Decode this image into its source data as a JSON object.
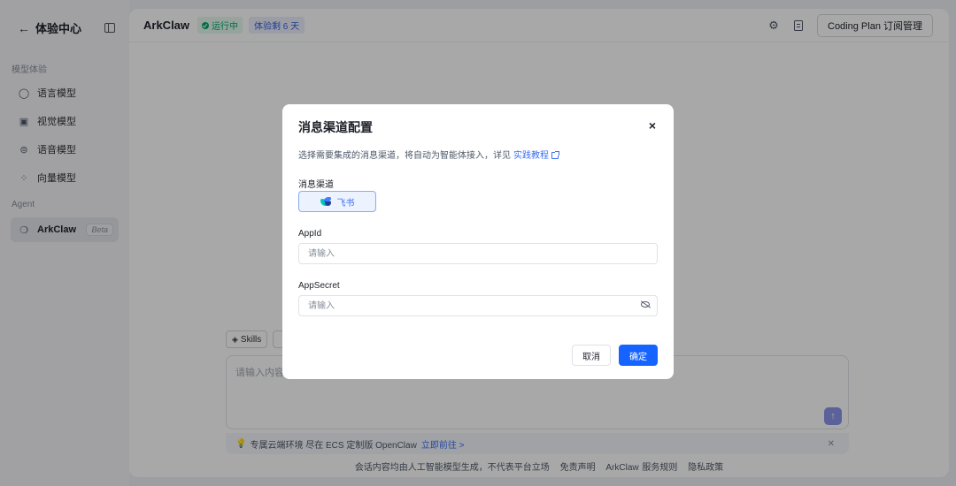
{
  "sidebar": {
    "back_icon": "arrow-left-icon",
    "title": "体验中心",
    "collapse_icon": "sidebar-collapse-icon",
    "section_model": "模型体验",
    "items": [
      {
        "label": "语言模型",
        "icon": "chat-bubble-icon"
      },
      {
        "label": "视觉模型",
        "icon": "image-icon"
      },
      {
        "label": "语音模型",
        "icon": "audio-icon"
      },
      {
        "label": "向量模型",
        "icon": "vector-icon"
      }
    ],
    "section_agent": "Agent",
    "agent_item": {
      "label": "ArkClaw",
      "badge": "Beta",
      "icon": "arkclaw-icon"
    }
  },
  "header": {
    "app_name": "ArkClaw",
    "status": "运行中",
    "trial": "体验剩 6 天",
    "plan_button": "Coding Plan 订阅管理",
    "settings_icon": "gear-icon",
    "doc_icon": "document-icon"
  },
  "chat": {
    "skills_label": "Skills",
    "input_placeholder": "请输入内容",
    "notice_text": "专属云端环境  尽在 ECS 定制版 OpenClaw",
    "notice_link": "立即前往 >",
    "footer": [
      "会话内容均由人工智能模型生成，不代表平台立场",
      "免责声明",
      "ArkClaw 服务规则",
      "隐私政策"
    ]
  },
  "modal": {
    "title": "消息渠道配置",
    "close": "×",
    "description": "选择需要集成的消息渠道，将自动为智能体接入，详见",
    "tutorial_link": "实践教程",
    "channel_label": "消息渠道",
    "channel_option": "飞书",
    "app_id_label": "AppId",
    "app_id_placeholder": "请输入",
    "app_secret_label": "AppSecret",
    "app_secret_placeholder": "请输入",
    "cancel": "取消",
    "confirm": "确定"
  },
  "colors": {
    "primary": "#1664ff",
    "status_green": "#00a870",
    "link": "#3b6ef5"
  }
}
